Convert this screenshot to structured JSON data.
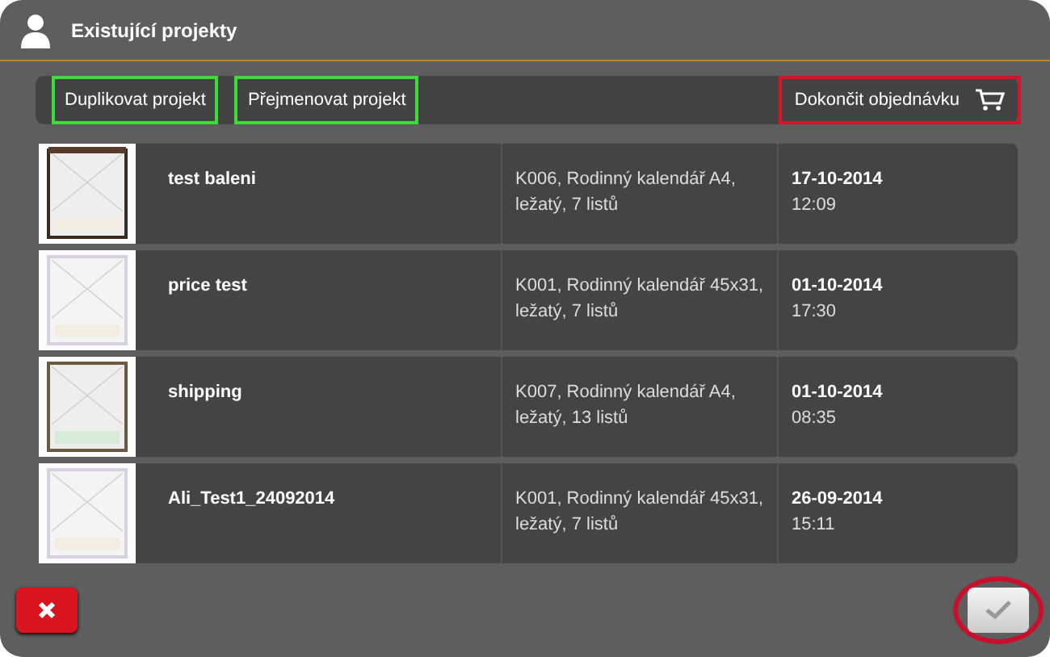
{
  "window": {
    "title": "Existující projekty"
  },
  "toolbar": {
    "buttons": [
      {
        "label": "Duplikovat projekt",
        "color": "#3ddc3d"
      },
      {
        "label": "Přejmenovat projekt",
        "color": "#3ddc3d"
      }
    ],
    "finish_button": {
      "label": "Dokončit objednávku",
      "color": "#d8142a"
    }
  },
  "projects": [
    {
      "name": "test baleni",
      "description": "K006, Rodinný kalendář A4, ležatý, 7 listů",
      "date": "17-10-2014",
      "time": "12:09"
    },
    {
      "name": "price test",
      "description": "K001, Rodinný kalendář 45x31, ležatý, 7 listů",
      "date": "01-10-2014",
      "time": "17:30"
    },
    {
      "name": "shipping",
      "description": "K007, Rodinný kalendář A4, ležatý, 13 listů",
      "date": "01-10-2014",
      "time": "08:35"
    },
    {
      "name": "Ali_Test1_24092014",
      "description": "K001, Rodinný kalendář 45x31, ležatý, 7 listů",
      "date": "26-09-2014",
      "time": "15:11"
    }
  ],
  "footer": {
    "confirm_ring": {
      "color": "#c8102e"
    }
  }
}
